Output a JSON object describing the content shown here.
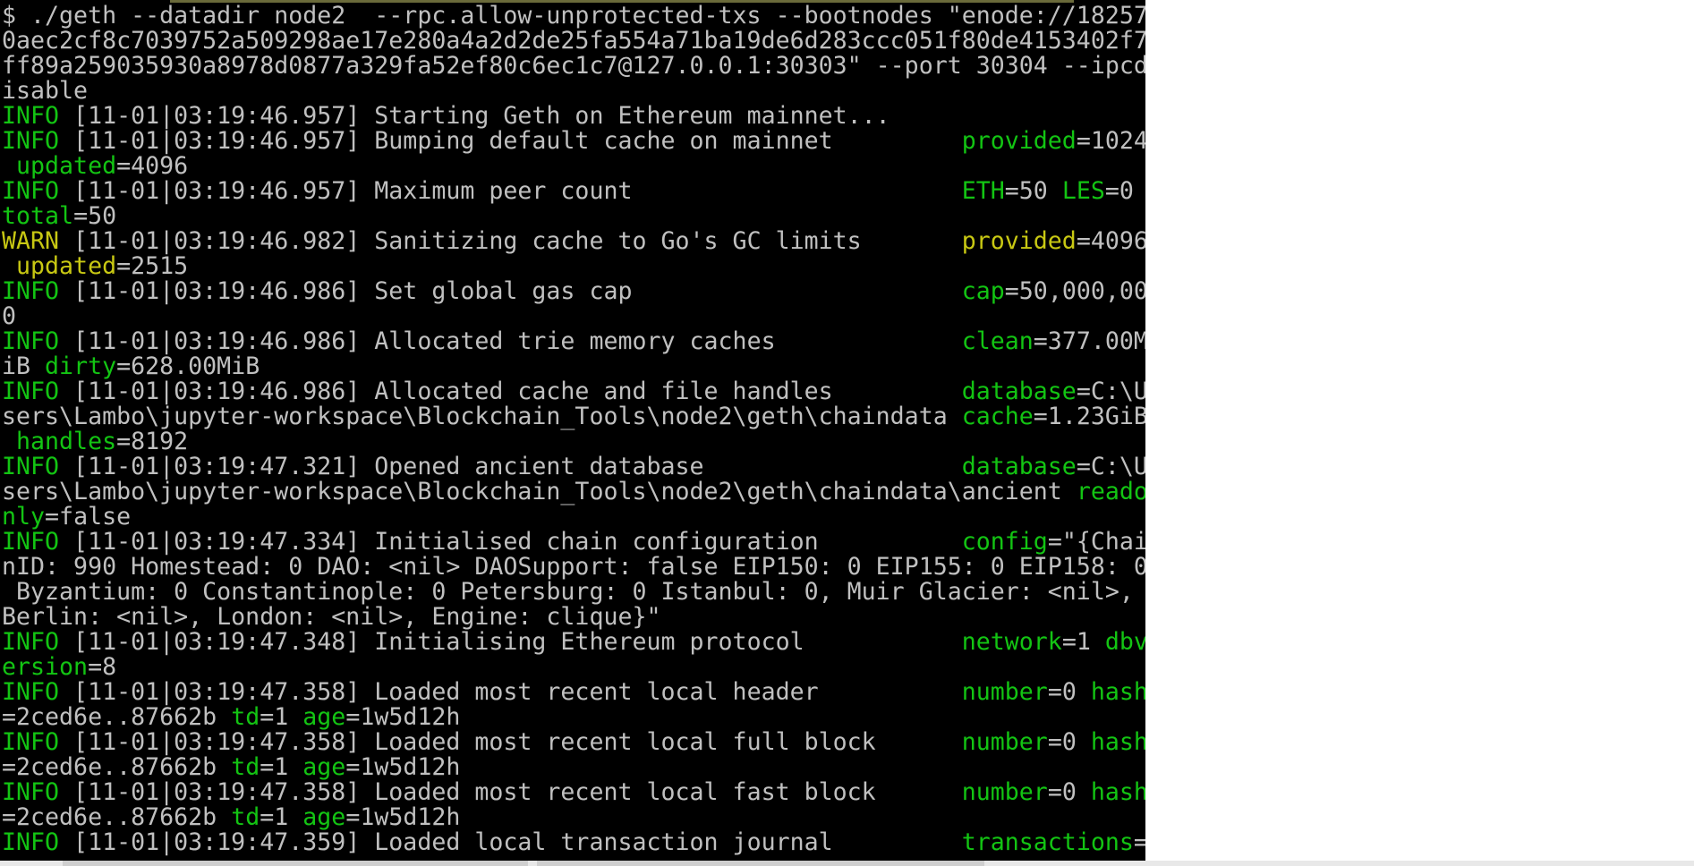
{
  "window": {
    "type": "terminal",
    "background": "#000000"
  },
  "colors": {
    "text": "#c0c0c0",
    "info": "#13c413",
    "warn": "#c8c813"
  },
  "lines": [
    [
      {
        "t": "$ ./geth --datadir node2  --rpc.allow-unprotected-txs --bootnodes \"enode://18257",
        "c": "white"
      }
    ],
    [
      {
        "t": "0aec2cf8c7039752a509298ae17e280a4a2d2de25fa554a71ba19de6d283ccc051f80de4153402f7",
        "c": "white"
      }
    ],
    [
      {
        "t": "ff89a259035930a8978d0877a329fa52ef80c6ec1c7@127.0.0.1:30303\" --port 30304 --ipcd",
        "c": "white"
      }
    ],
    [
      {
        "t": "isable",
        "c": "white"
      }
    ],
    [
      {
        "t": "INFO",
        "c": "green"
      },
      {
        "t": " [11-01|03:19:46.957] Starting Geth on Ethereum mainnet...",
        "c": "white"
      }
    ],
    [
      {
        "t": "INFO",
        "c": "green"
      },
      {
        "t": " [11-01|03:19:46.957] Bumping default cache on mainnet         ",
        "c": "white"
      },
      {
        "t": "provided",
        "c": "green"
      },
      {
        "t": "=1024",
        "c": "white"
      }
    ],
    [
      {
        "t": " updated",
        "c": "green"
      },
      {
        "t": "=4096",
        "c": "white"
      }
    ],
    [
      {
        "t": "INFO",
        "c": "green"
      },
      {
        "t": " [11-01|03:19:46.957] Maximum peer count                       ",
        "c": "white"
      },
      {
        "t": "ETH",
        "c": "green"
      },
      {
        "t": "=50 ",
        "c": "white"
      },
      {
        "t": "LES",
        "c": "green"
      },
      {
        "t": "=0",
        "c": "white"
      }
    ],
    [
      {
        "t": "total",
        "c": "green"
      },
      {
        "t": "=50",
        "c": "white"
      }
    ],
    [
      {
        "t": "WARN",
        "c": "yellow"
      },
      {
        "t": " [11-01|03:19:46.982] Sanitizing cache to Go's GC limits       ",
        "c": "white"
      },
      {
        "t": "provided",
        "c": "yellow"
      },
      {
        "t": "=4096",
        "c": "white"
      }
    ],
    [
      {
        "t": " updated",
        "c": "yellow"
      },
      {
        "t": "=2515",
        "c": "white"
      }
    ],
    [
      {
        "t": "INFO",
        "c": "green"
      },
      {
        "t": " [11-01|03:19:46.986] Set global gas cap                       ",
        "c": "white"
      },
      {
        "t": "cap",
        "c": "green"
      },
      {
        "t": "=50,000,00",
        "c": "white"
      }
    ],
    [
      {
        "t": "0",
        "c": "white"
      }
    ],
    [
      {
        "t": "INFO",
        "c": "green"
      },
      {
        "t": " [11-01|03:19:46.986] Allocated trie memory caches             ",
        "c": "white"
      },
      {
        "t": "clean",
        "c": "green"
      },
      {
        "t": "=377.00M",
        "c": "white"
      }
    ],
    [
      {
        "t": "iB ",
        "c": "white"
      },
      {
        "t": "dirty",
        "c": "green"
      },
      {
        "t": "=628.00MiB",
        "c": "white"
      }
    ],
    [
      {
        "t": "INFO",
        "c": "green"
      },
      {
        "t": " [11-01|03:19:46.986] Allocated cache and file handles         ",
        "c": "white"
      },
      {
        "t": "database",
        "c": "green"
      },
      {
        "t": "=C:\\U",
        "c": "white"
      }
    ],
    [
      {
        "t": "sers\\Lambo\\jupyter-workspace\\Blockchain_Tools\\node2\\geth\\chaindata ",
        "c": "white"
      },
      {
        "t": "cache",
        "c": "green"
      },
      {
        "t": "=1.23GiB",
        "c": "white"
      }
    ],
    [
      {
        "t": " handles",
        "c": "green"
      },
      {
        "t": "=8192",
        "c": "white"
      }
    ],
    [
      {
        "t": "INFO",
        "c": "green"
      },
      {
        "t": " [11-01|03:19:47.321] Opened ancient database                  ",
        "c": "white"
      },
      {
        "t": "database",
        "c": "green"
      },
      {
        "t": "=C:\\U",
        "c": "white"
      }
    ],
    [
      {
        "t": "sers\\Lambo\\jupyter-workspace\\Blockchain_Tools\\node2\\geth\\chaindata\\ancient ",
        "c": "white"
      },
      {
        "t": "reado",
        "c": "green"
      }
    ],
    [
      {
        "t": "nly",
        "c": "green"
      },
      {
        "t": "=false",
        "c": "white"
      }
    ],
    [
      {
        "t": "INFO",
        "c": "green"
      },
      {
        "t": " [11-01|03:19:47.334] Initialised chain configuration          ",
        "c": "white"
      },
      {
        "t": "config",
        "c": "green"
      },
      {
        "t": "=\"{Chai",
        "c": "white"
      }
    ],
    [
      {
        "t": "nID: 990 Homestead: 0 DAO: <nil> DAOSupport: false EIP150: 0 EIP155: 0 EIP158: 0",
        "c": "white"
      }
    ],
    [
      {
        "t": " Byzantium: 0 Constantinople: 0 Petersburg: 0 Istanbul: 0, Muir Glacier: <nil>,",
        "c": "white"
      }
    ],
    [
      {
        "t": "Berlin: <nil>, London: <nil>, Engine: clique}\"",
        "c": "white"
      }
    ],
    [
      {
        "t": "INFO",
        "c": "green"
      },
      {
        "t": " [11-01|03:19:47.348] Initialising Ethereum protocol           ",
        "c": "white"
      },
      {
        "t": "network",
        "c": "green"
      },
      {
        "t": "=1 ",
        "c": "white"
      },
      {
        "t": "dbv",
        "c": "green"
      }
    ],
    [
      {
        "t": "ersion",
        "c": "green"
      },
      {
        "t": "=8",
        "c": "white"
      }
    ],
    [
      {
        "t": "INFO",
        "c": "green"
      },
      {
        "t": " [11-01|03:19:47.358] Loaded most recent local header          ",
        "c": "white"
      },
      {
        "t": "number",
        "c": "green"
      },
      {
        "t": "=0 ",
        "c": "white"
      },
      {
        "t": "hash",
        "c": "green"
      }
    ],
    [
      {
        "t": "=2ced6e..87662b ",
        "c": "white"
      },
      {
        "t": "td",
        "c": "green"
      },
      {
        "t": "=1 ",
        "c": "white"
      },
      {
        "t": "age",
        "c": "green"
      },
      {
        "t": "=1w5d12h",
        "c": "white"
      }
    ],
    [
      {
        "t": "INFO",
        "c": "green"
      },
      {
        "t": " [11-01|03:19:47.358] Loaded most recent local full block      ",
        "c": "white"
      },
      {
        "t": "number",
        "c": "green"
      },
      {
        "t": "=0 ",
        "c": "white"
      },
      {
        "t": "hash",
        "c": "green"
      }
    ],
    [
      {
        "t": "=2ced6e..87662b ",
        "c": "white"
      },
      {
        "t": "td",
        "c": "green"
      },
      {
        "t": "=1 ",
        "c": "white"
      },
      {
        "t": "age",
        "c": "green"
      },
      {
        "t": "=1w5d12h",
        "c": "white"
      }
    ],
    [
      {
        "t": "INFO",
        "c": "green"
      },
      {
        "t": " [11-01|03:19:47.358] Loaded most recent local fast block      ",
        "c": "white"
      },
      {
        "t": "number",
        "c": "green"
      },
      {
        "t": "=0 ",
        "c": "white"
      },
      {
        "t": "hash",
        "c": "green"
      }
    ],
    [
      {
        "t": "=2ced6e..87662b ",
        "c": "white"
      },
      {
        "t": "td",
        "c": "green"
      },
      {
        "t": "=1 ",
        "c": "white"
      },
      {
        "t": "age",
        "c": "green"
      },
      {
        "t": "=1w5d12h",
        "c": "white"
      }
    ],
    [
      {
        "t": "INFO",
        "c": "green"
      },
      {
        "t": " [11-01|03:19:47.359] Loaded local transaction journal         ",
        "c": "white"
      },
      {
        "t": "transactions",
        "c": "green"
      },
      {
        "t": "=",
        "c": "white"
      }
    ]
  ]
}
